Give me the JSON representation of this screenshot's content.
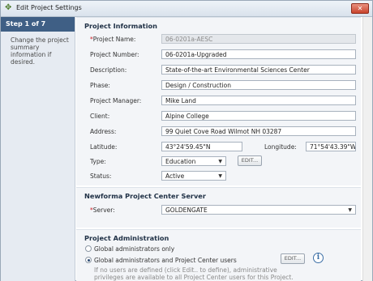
{
  "window": {
    "title": "Edit Project Settings",
    "close_label": "✕"
  },
  "sidebar": {
    "step": "Step 1 of 7",
    "description": "Change the project summary information if desired."
  },
  "project_info": {
    "heading": "Project Information",
    "fields": {
      "name_label": "Project Name:",
      "name": "06-0201a-AESC",
      "number_label": "Project Number:",
      "number": "06-0201a-Upgraded",
      "description_label": "Description:",
      "description": "State-of-the-art Environmental Sciences Center",
      "phase_label": "Phase:",
      "phase": "Design / Construction",
      "manager_label": "Project Manager:",
      "manager": "Mike Land",
      "client_label": "Client:",
      "client": "Alpine College",
      "address_label": "Address:",
      "address": "99 Quiet Cove Road Wilmot NH 03287",
      "latitude_label": "Latitude:",
      "latitude": "43°24'59.45\"N",
      "longitude_label": "Longitude:",
      "longitude": "71°54'43.39\"W",
      "type_label": "Type:",
      "type": "Education",
      "edit_label": "EDIT...",
      "status_label": "Status:",
      "status": "Active"
    }
  },
  "server": {
    "heading": "Newforma Project Center Server",
    "server_label": "Server:",
    "server": "GOLDENGATE"
  },
  "admin": {
    "heading": "Project Administration",
    "option_global": "Global administrators only",
    "option_global_and_users": "Global administrators and Project Center users",
    "edit_label": "EDIT...",
    "info": "i",
    "note": "If no users are defined (click Edit.. to define), administrative privileges are available to all Project Center users for this Project."
  },
  "icons": {
    "title": "newforma-logo-icon",
    "close": "close-icon",
    "dropdown": "chevron-down-icon",
    "info": "info-icon"
  },
  "colors": {
    "sidebar_header": "#3f5f85",
    "required": "#c9242a",
    "close": "#c9442d"
  }
}
